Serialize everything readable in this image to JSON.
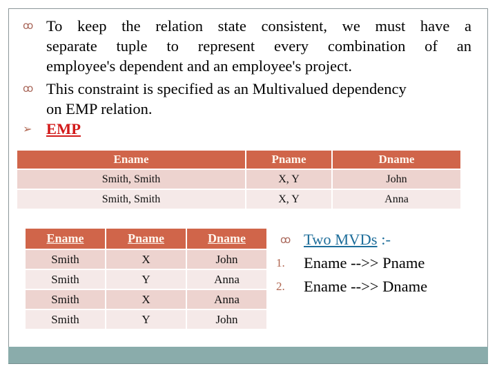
{
  "slide": {
    "bullets": [
      {
        "icon": "scroll-bullet-icon",
        "glyph": "ꝏ",
        "lines": [
          "To keep the relation state consistent, we must have a",
          "separate tuple to represent every combination of an",
          "employee's dependent and an employee's project."
        ]
      },
      {
        "icon": "scroll-bullet-icon",
        "glyph": "ꝏ",
        "lines": [
          "This constraint is specified as an Multivalued dependency",
          "on EMP relation."
        ]
      }
    ],
    "emp_heading": {
      "glyph": "➢",
      "text": "EMP",
      "color": "#d21a1a"
    },
    "table_grouped": {
      "headers": [
        "Ename",
        "Pname",
        "Dname"
      ],
      "rows": [
        [
          "Smith, Smith",
          "X, Y",
          "John"
        ],
        [
          "Smith, Smith",
          "X, Y",
          "Anna"
        ]
      ]
    },
    "table_flat": {
      "headers": [
        "Ename",
        "Pname",
        "Dname"
      ],
      "rows": [
        [
          "Smith",
          "X",
          "John"
        ],
        [
          "Smith",
          "Y",
          "Anna"
        ],
        [
          "Smith",
          "X",
          "Anna"
        ],
        [
          "Smith",
          "Y",
          "John"
        ]
      ]
    },
    "mvds": {
      "bullet_glyph": "ꝏ",
      "title": "Two MVDs",
      "title_suffix": " :-",
      "items": [
        {
          "num": "1.",
          "text": "Ename -->> Pname"
        },
        {
          "num": "2.",
          "text": "Ename -->> Dname"
        }
      ]
    },
    "colors": {
      "header_fill": "#d0654a",
      "row_odd": "#edd3cf",
      "row_even": "#f5e9e8",
      "footer_bar": "#8aacab",
      "link_blue": "#1d6d9a",
      "bullet_accent": "#a9675a"
    }
  }
}
